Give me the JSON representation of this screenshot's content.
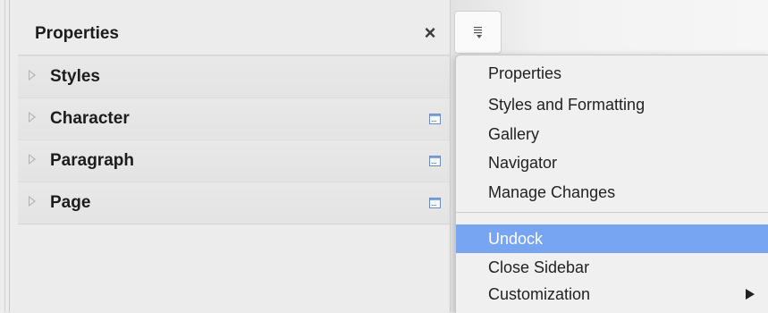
{
  "panel": {
    "title": "Properties",
    "close_label": "×",
    "decks": [
      {
        "label": "Styles",
        "has_more_button": false
      },
      {
        "label": "Character",
        "has_more_button": true
      },
      {
        "label": "Paragraph",
        "has_more_button": true
      },
      {
        "label": "Page",
        "has_more_button": true
      }
    ]
  },
  "menu": {
    "items": [
      {
        "label": "Properties"
      },
      {
        "label": "Styles and Formatting"
      },
      {
        "label": "Gallery"
      },
      {
        "label": "Navigator"
      },
      {
        "label": "Manage Changes"
      },
      {
        "label": "Undock",
        "highlighted": true
      },
      {
        "label": "Close Sidebar"
      },
      {
        "label": "Customization",
        "submenu": true
      }
    ]
  },
  "colors": {
    "highlight": "#78a5f2",
    "panel_bg": "#ececec",
    "more_button_border": "#6a8fbf"
  },
  "icons": {
    "close": "close-icon",
    "menu_toggle": "sidebar-menu-icon",
    "deck_expand": "disclosure-triangle-icon",
    "more_options": "more-options-icon",
    "submenu": "submenu-arrow-icon"
  }
}
